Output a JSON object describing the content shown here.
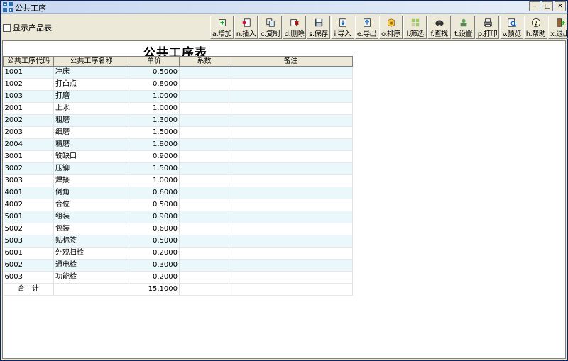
{
  "window": {
    "title": "公共工序"
  },
  "toolbar": {
    "show_products_label": "显示产品表",
    "buttons": [
      {
        "label": "a.增加",
        "icon": "add-icon"
      },
      {
        "label": "n.插入",
        "icon": "insert-icon"
      },
      {
        "label": "c.复制",
        "icon": "copy-icon"
      },
      {
        "label": "d.删除",
        "icon": "delete-icon"
      },
      {
        "label": "s.保存",
        "icon": "save-icon"
      },
      {
        "label": "i.导入",
        "icon": "import-icon"
      },
      {
        "label": "e.导出",
        "icon": "export-icon"
      },
      {
        "label": "o.排序",
        "icon": "sort-icon"
      },
      {
        "label": "l.筛选",
        "icon": "filter-icon"
      },
      {
        "label": "f.查找",
        "icon": "find-icon"
      },
      {
        "label": "t.设置",
        "icon": "settings-icon"
      },
      {
        "label": "p.打印",
        "icon": "print-icon"
      },
      {
        "label": "v.预览",
        "icon": "preview-icon"
      },
      {
        "label": "h.帮助",
        "icon": "help-icon"
      },
      {
        "label": "x.退出",
        "icon": "exit-icon"
      }
    ]
  },
  "report": {
    "title": "公共工序表",
    "columns": [
      "公共工序代码",
      "公共工序名称",
      "单价",
      "系数",
      "备注"
    ],
    "rows": [
      {
        "code": "1001",
        "name": "冲床",
        "price": "0.5000",
        "coef": "",
        "note": ""
      },
      {
        "code": "1002",
        "name": "打凸点",
        "price": "0.8000",
        "coef": "",
        "note": ""
      },
      {
        "code": "1003",
        "name": "打磨",
        "price": "1.0000",
        "coef": "",
        "note": ""
      },
      {
        "code": "2001",
        "name": "上水",
        "price": "1.0000",
        "coef": "",
        "note": ""
      },
      {
        "code": "2002",
        "name": "粗磨",
        "price": "1.3000",
        "coef": "",
        "note": ""
      },
      {
        "code": "2003",
        "name": "细磨",
        "price": "1.5000",
        "coef": "",
        "note": ""
      },
      {
        "code": "2004",
        "name": "精磨",
        "price": "1.8000",
        "coef": "",
        "note": ""
      },
      {
        "code": "3001",
        "name": "铣缺口",
        "price": "0.9000",
        "coef": "",
        "note": ""
      },
      {
        "code": "3002",
        "name": "压铆",
        "price": "1.5000",
        "coef": "",
        "note": ""
      },
      {
        "code": "3003",
        "name": "焊接",
        "price": "1.0000",
        "coef": "",
        "note": ""
      },
      {
        "code": "4001",
        "name": "倒角",
        "price": "0.6000",
        "coef": "",
        "note": ""
      },
      {
        "code": "4002",
        "name": "合位",
        "price": "0.5000",
        "coef": "",
        "note": ""
      },
      {
        "code": "5001",
        "name": "组装",
        "price": "0.9000",
        "coef": "",
        "note": ""
      },
      {
        "code": "5002",
        "name": "包装",
        "price": "0.6000",
        "coef": "",
        "note": ""
      },
      {
        "code": "5003",
        "name": "贴标签",
        "price": "0.5000",
        "coef": "",
        "note": ""
      },
      {
        "code": "6001",
        "name": "外观扫检",
        "price": "0.2000",
        "coef": "",
        "note": ""
      },
      {
        "code": "6002",
        "name": "通电检",
        "price": "0.3000",
        "coef": "",
        "note": ""
      },
      {
        "code": "6003",
        "name": "功能检",
        "price": "0.2000",
        "coef": "",
        "note": ""
      }
    ],
    "total": {
      "label": "合　计",
      "price": "15.1000"
    }
  }
}
